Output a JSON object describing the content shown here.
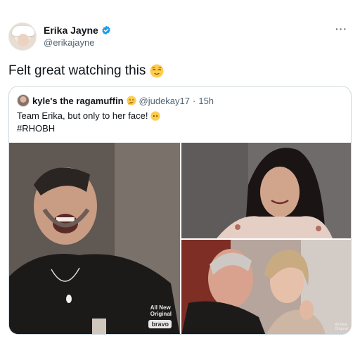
{
  "tweet": {
    "display_name": "Erika Jayne",
    "handle": "@erikajayne",
    "more": "···",
    "text": "Felt great watching this",
    "text_emoji": "relieved-face"
  },
  "quoted": {
    "display_name": "kyle's the ragamuffin",
    "name_emoji": "thinking-face",
    "handle": "@judekay17",
    "separator": "·",
    "time": "15h",
    "text_line1": "Team Erika, but only to her face!",
    "line1_emoji": "face-without-mouth",
    "text_line2": "#RHOBH"
  },
  "media": {
    "left_watermark_line1": "All New",
    "left_watermark_line2": "Original",
    "left_brand": "bravo",
    "br_watermark_line1": "All New",
    "br_watermark_line2": "Original"
  },
  "colors": {
    "accent_blue": "#1d9bf0",
    "secondary_text": "#536471",
    "border": "#cfd9de"
  }
}
